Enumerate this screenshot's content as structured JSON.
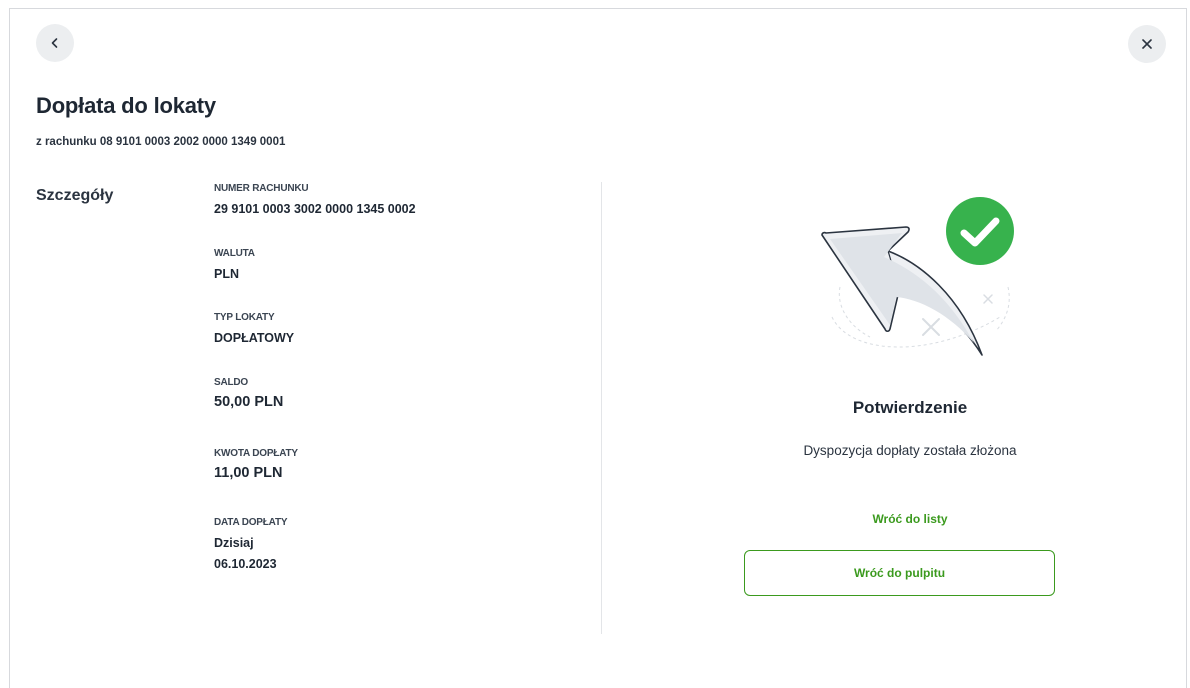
{
  "header": {
    "title": "Dopłata do lokaty",
    "subtitle": "z rachunku 08 9101 0003 2002 0000 1349 0001"
  },
  "details": {
    "section_title": "Szczegóły",
    "fields": [
      {
        "label": "NUMER RACHUNKU",
        "value": "29 9101 0003 3002 0000 1345 0002"
      },
      {
        "label": "WALUTA",
        "value": "PLN"
      },
      {
        "label": "TYP LOKATY",
        "value": "DOPŁATOWY"
      },
      {
        "label": "SALDO",
        "value": "50,00 PLN"
      },
      {
        "label": "KWOTA DOPŁATY",
        "value": "11,00 PLN"
      },
      {
        "label": "DATA DOPŁATY",
        "value": "Dzisiaj",
        "value2": "06.10.2023"
      }
    ]
  },
  "confirmation": {
    "title": "Potwierdzenie",
    "message": "Dyspozycja dopłaty została złożona",
    "back_to_list": "Wróć do listy",
    "back_to_dashboard": "Wróć do pulpitu"
  },
  "icons": {
    "back": "chevron-left-icon",
    "close": "close-icon",
    "illustration": "return-arrow-success-illustration"
  },
  "colors": {
    "accent": "#3b9a1e",
    "success": "#37b24d",
    "text": "#1e2733"
  }
}
